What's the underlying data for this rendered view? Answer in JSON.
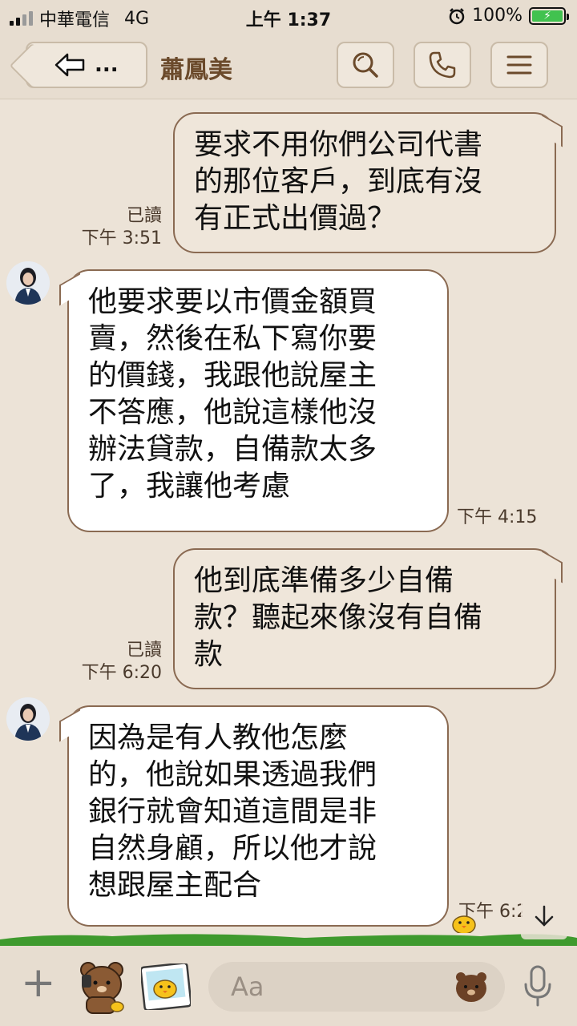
{
  "status_bar": {
    "carrier": "中華電信",
    "network": "4G",
    "time": "上午 1:37",
    "battery": "100%"
  },
  "header": {
    "back_label": "...",
    "chat_name": "蕭鳳美"
  },
  "messages": [
    {
      "side": "out",
      "text": "要求不用你們公司代書\n的那位客戶，到底有沒\n有正式出價過？",
      "read": "已讀",
      "time": "下午 3:51"
    },
    {
      "side": "in",
      "text": "他要求要以市價金額買\n賣，然後在私下寫你要\n的價錢，我跟他說屋主\n不答應，他說這樣他沒\n辦法貸款，自備款太多\n了，我讓他考慮",
      "time": "下午 4:15"
    },
    {
      "side": "out",
      "text": "他到底準備多少自備\n款？聽起來像沒有自備\n款",
      "read": "已讀",
      "time": "下午 6:20"
    },
    {
      "side": "in",
      "text": "因為是有人教他怎麼\n的，他說如果透過我們\n銀行就會知道這間是非\n自然身顧，所以他才說\n想跟屋主配合",
      "time": "下午 6:2"
    }
  ],
  "input": {
    "placeholder": "Aa"
  },
  "colors": {
    "background": "#ece3d7",
    "bubble_border": "#8a6a52",
    "title": "#6b4a2b"
  }
}
